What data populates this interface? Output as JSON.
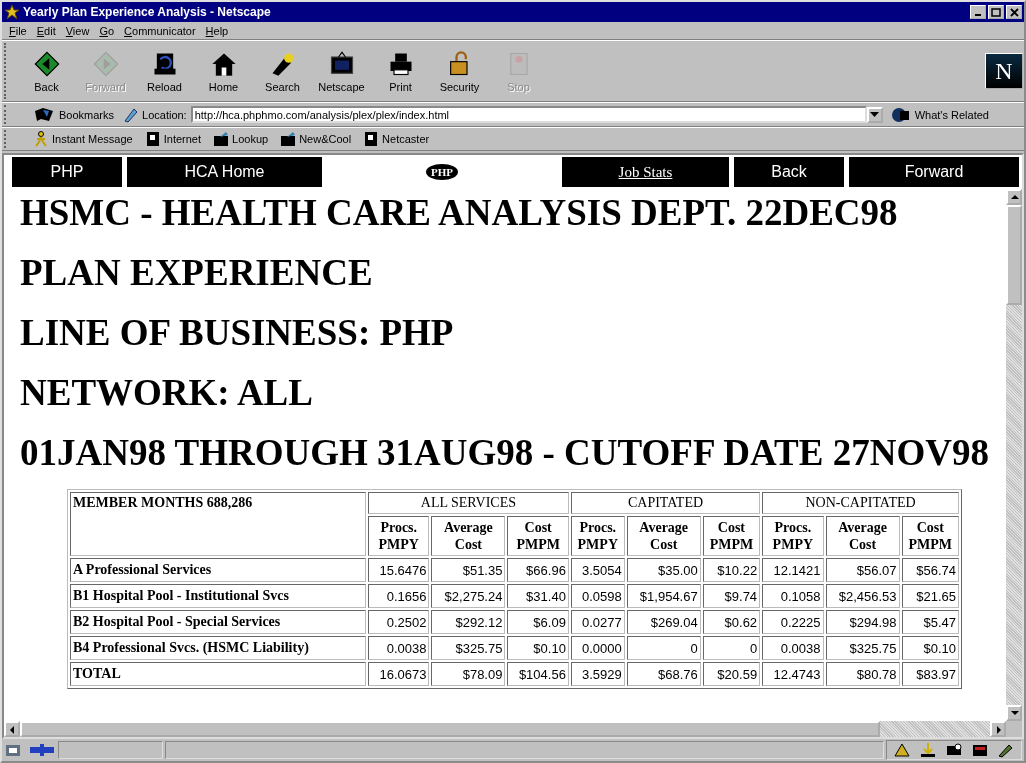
{
  "window": {
    "title": "Yearly Plan Experience Analysis - Netscape"
  },
  "menu": [
    "File",
    "Edit",
    "View",
    "Go",
    "Communicator",
    "Help"
  ],
  "toolbar": [
    {
      "label": "Back",
      "disabled": false
    },
    {
      "label": "Forward",
      "disabled": true
    },
    {
      "label": "Reload",
      "disabled": false
    },
    {
      "label": "Home",
      "disabled": false
    },
    {
      "label": "Search",
      "disabled": false
    },
    {
      "label": "Netscape",
      "disabled": false
    },
    {
      "label": "Print",
      "disabled": false
    },
    {
      "label": "Security",
      "disabled": false
    },
    {
      "label": "Stop",
      "disabled": true
    }
  ],
  "throbber_letter": "N",
  "location_bar": {
    "bookmarks": "Bookmarks",
    "location_label": "Location:",
    "url": "http://hca.phphmo.com/analysis/plex/plex/index.html",
    "whats_related": "What's Related"
  },
  "personal_toolbar": [
    "Instant Message",
    "Internet",
    "Lookup",
    "New&Cool",
    "Netcaster"
  ],
  "nav": [
    {
      "label": "PHP",
      "kind": "button"
    },
    {
      "label": "HCA Home",
      "kind": "button"
    },
    {
      "label": "PHP",
      "kind": "logo"
    },
    {
      "label": "Job Stats",
      "kind": "link"
    },
    {
      "label": "Back",
      "kind": "button"
    },
    {
      "label": "Forward",
      "kind": "button"
    }
  ],
  "headings": [
    "HSMC - HEALTH CARE ANALYSIS DEPT. 22DEC98",
    "PLAN EXPERIENCE",
    "LINE OF BUSINESS: PHP",
    "NETWORK: ALL",
    "01JAN98 THROUGH 31AUG98 - CUTOFF DATE 27NOV98"
  ],
  "table": {
    "corner": "MEMBER MONTHS 688,286",
    "groups": [
      "ALL SERVICES",
      "CAPITATED",
      "NON-CAPITATED"
    ],
    "subcolumns": [
      "Procs.\nPMPY",
      "Average\nCost",
      "Cost\nPMPM",
      "Procs.\nPMPY",
      "Average\nCost",
      "Cost\nPMPM",
      "Procs.\nPMPY",
      "Average\nCost",
      "Cost\nPMPM"
    ],
    "rows": [
      {
        "label": "A Professional Services",
        "values": [
          "15.6476",
          "$51.35",
          "$66.96",
          "3.5054",
          "$35.00",
          "$10.22",
          "12.1421",
          "$56.07",
          "$56.74"
        ]
      },
      {
        "label": "B1 Hospital Pool - Institutional Svcs",
        "values": [
          "0.1656",
          "$2,275.24",
          "$31.40",
          "0.0598",
          "$1,954.67",
          "$9.74",
          "0.1058",
          "$2,456.53",
          "$21.65"
        ]
      },
      {
        "label": "B2 Hospital Pool - Special Services",
        "values": [
          "0.2502",
          "$292.12",
          "$6.09",
          "0.0277",
          "$269.04",
          "$0.62",
          "0.2225",
          "$294.98",
          "$5.47"
        ]
      },
      {
        "label": "B4 Professional Svcs. (HSMC Liability)",
        "values": [
          "0.0038",
          "$325.75",
          "$0.10",
          "0.0000",
          "0",
          "0",
          "0.0038",
          "$325.75",
          "$0.10"
        ]
      },
      {
        "label": "TOTAL",
        "values": [
          "16.0673",
          "$78.09",
          "$104.56",
          "3.5929",
          "$68.76",
          "$20.59",
          "12.4743",
          "$80.78",
          "$83.97"
        ]
      }
    ]
  }
}
